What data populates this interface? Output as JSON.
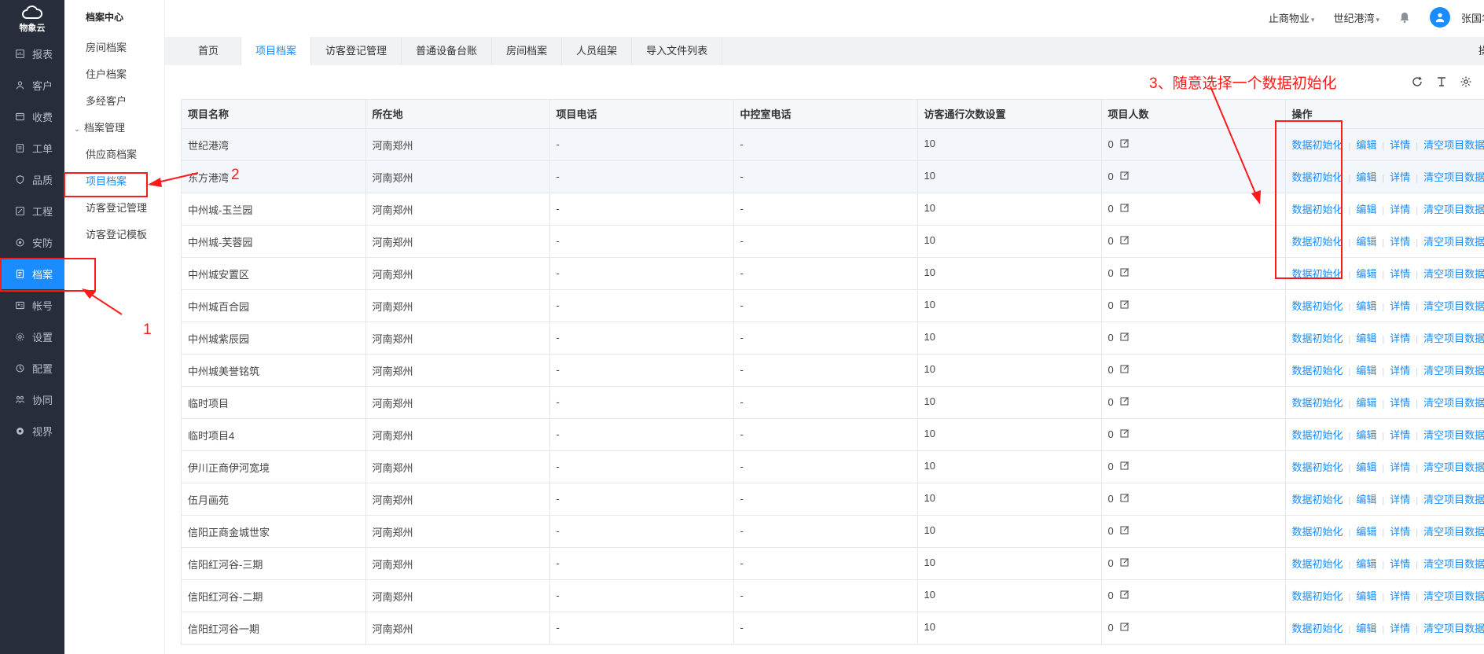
{
  "app": {
    "logo_text": "物象云"
  },
  "rail": {
    "items": [
      {
        "label": "报表",
        "icon": "report-icon"
      },
      {
        "label": "客户",
        "icon": "customer-icon"
      },
      {
        "label": "收费",
        "icon": "fee-icon"
      },
      {
        "label": "工单",
        "icon": "workorder-icon"
      },
      {
        "label": "品质",
        "icon": "quality-icon"
      },
      {
        "label": "工程",
        "icon": "engineering-icon"
      },
      {
        "label": "安防",
        "icon": "security-icon"
      },
      {
        "label": "档案",
        "icon": "archive-icon",
        "active": true
      },
      {
        "label": "帐号",
        "icon": "account-icon"
      },
      {
        "label": "设置",
        "icon": "settings-icon"
      },
      {
        "label": "配置",
        "icon": "config-icon"
      },
      {
        "label": "协同",
        "icon": "collab-icon"
      },
      {
        "label": "视界",
        "icon": "vision-icon"
      }
    ]
  },
  "submenu": {
    "title": "档案中心",
    "items": [
      {
        "label": "房间档案"
      },
      {
        "label": "住户档案"
      },
      {
        "label": "多经客户"
      },
      {
        "label": "档案管理"
      },
      {
        "label": "供应商档案"
      },
      {
        "label": "项目档案"
      },
      {
        "label": "访客登记管理"
      },
      {
        "label": "访客登记模板"
      }
    ]
  },
  "header": {
    "company": "止商物业",
    "project": "世纪港湾",
    "user": "张国华"
  },
  "tabs": {
    "items": [
      "首页",
      "项目档案",
      "访客登记管理",
      "普通设备台账",
      "房间档案",
      "人员组架",
      "导入文件列表"
    ],
    "right": "操"
  },
  "table": {
    "headers": [
      "项目名称",
      "所在地",
      "项目电话",
      "中控室电话",
      "访客通行次数设置",
      "项目人数",
      "操作"
    ],
    "actions": [
      "数据初始化",
      "编辑",
      "详情",
      "清空项目数据"
    ],
    "rows": [
      {
        "name": "世纪港湾",
        "location": "河南郑州",
        "phone": "-",
        "control_phone": "-",
        "visits": "10",
        "count": "0"
      },
      {
        "name": "东方港湾",
        "location": "河南郑州",
        "phone": "-",
        "control_phone": "-",
        "visits": "10",
        "count": "0"
      },
      {
        "name": "中州城-玉兰园",
        "location": "河南郑州",
        "phone": "-",
        "control_phone": "-",
        "visits": "10",
        "count": "0"
      },
      {
        "name": "中州城-芙蓉园",
        "location": "河南郑州",
        "phone": "-",
        "control_phone": "-",
        "visits": "10",
        "count": "0"
      },
      {
        "name": "中州城安置区",
        "location": "河南郑州",
        "phone": "-",
        "control_phone": "-",
        "visits": "10",
        "count": "0"
      },
      {
        "name": "中州城百合园",
        "location": "河南郑州",
        "phone": "-",
        "control_phone": "-",
        "visits": "10",
        "count": "0"
      },
      {
        "name": "中州城紫辰园",
        "location": "河南郑州",
        "phone": "-",
        "control_phone": "-",
        "visits": "10",
        "count": "0"
      },
      {
        "name": "中州城美誉铭筑",
        "location": "河南郑州",
        "phone": "-",
        "control_phone": "-",
        "visits": "10",
        "count": "0"
      },
      {
        "name": "临时项目",
        "location": "河南郑州",
        "phone": "-",
        "control_phone": "-",
        "visits": "10",
        "count": "0"
      },
      {
        "name": "临时项目4",
        "location": "河南郑州",
        "phone": "-",
        "control_phone": "-",
        "visits": "10",
        "count": "0"
      },
      {
        "name": "伊川正商伊河宽境",
        "location": "河南郑州",
        "phone": "-",
        "control_phone": "-",
        "visits": "10",
        "count": "0"
      },
      {
        "name": "伍月画苑",
        "location": "河南郑州",
        "phone": "-",
        "control_phone": "-",
        "visits": "10",
        "count": "0"
      },
      {
        "name": "信阳正商金城世家",
        "location": "河南郑州",
        "phone": "-",
        "control_phone": "-",
        "visits": "10",
        "count": "0"
      },
      {
        "name": "信阳红河谷-三期",
        "location": "河南郑州",
        "phone": "-",
        "control_phone": "-",
        "visits": "10",
        "count": "0"
      },
      {
        "name": "信阳红河谷-二期",
        "location": "河南郑州",
        "phone": "-",
        "control_phone": "-",
        "visits": "10",
        "count": "0"
      },
      {
        "name": "信阳红河谷一期",
        "location": "河南郑州",
        "phone": "-",
        "control_phone": "-",
        "visits": "10",
        "count": "0"
      }
    ]
  },
  "annotations": {
    "step1": "1",
    "step2": "2",
    "step3": "3、随意选择一个数据初始化",
    "color": "#ff1a1a"
  }
}
